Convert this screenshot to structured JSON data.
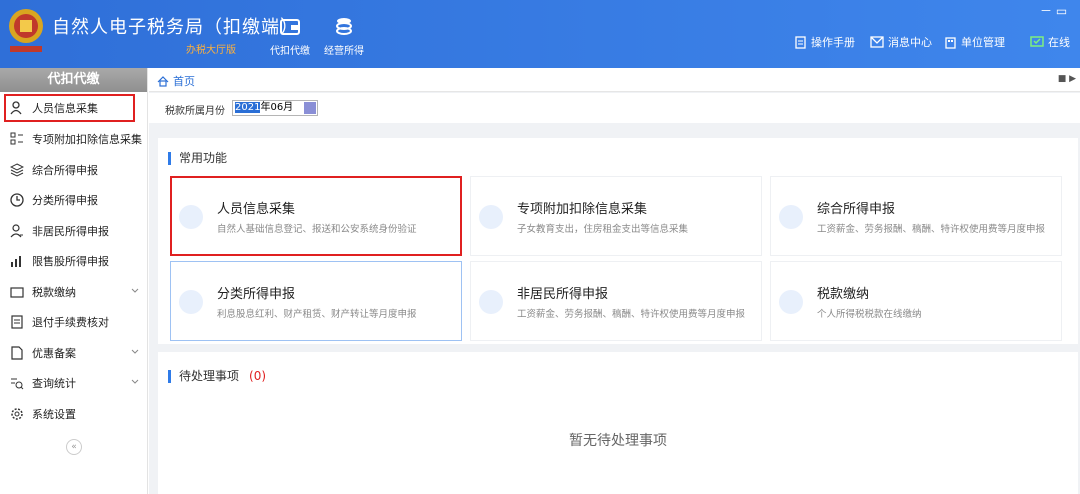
{
  "header": {
    "title": "自然人电子税务局（扣缴端）",
    "subtitle": "办税大厅版",
    "nav": [
      {
        "label": "代扣代缴",
        "icon": "wallet-icon"
      },
      {
        "label": "经营所得",
        "icon": "coins-icon"
      }
    ],
    "right": [
      {
        "label": "操作手册",
        "icon": "manual-icon"
      },
      {
        "label": "消息中心",
        "icon": "mail-icon"
      },
      {
        "label": "单位管理",
        "icon": "building-icon"
      },
      {
        "label": "在线",
        "icon": "online-icon"
      }
    ],
    "window_controls": "－ ▭"
  },
  "sidebar": {
    "heading": "代扣代缴",
    "items": [
      {
        "label": "人员信息采集",
        "icon": "user-icon"
      },
      {
        "label": "专项附加扣除信息采集",
        "icon": "grid-list-icon"
      },
      {
        "label": "综合所得申报",
        "icon": "layers-icon"
      },
      {
        "label": "分类所得申报",
        "icon": "clock-pie-icon"
      },
      {
        "label": "非居民所得申报",
        "icon": "person-icon"
      },
      {
        "label": "限售股所得申报",
        "icon": "bar-chart-icon"
      },
      {
        "label": "税款缴纳",
        "icon": "folder-icon"
      },
      {
        "label": "退付手续费核对",
        "icon": "receipt-icon"
      },
      {
        "label": "优惠备案",
        "icon": "document-icon"
      },
      {
        "label": "查询统计",
        "icon": "search-list-icon"
      },
      {
        "label": "系统设置",
        "icon": "gear-icon"
      }
    ],
    "collapse": "«"
  },
  "breadcrumb": {
    "home": "首页"
  },
  "filter": {
    "label": "税款所属月份",
    "value_sel": "2021",
    "value_rest": "年06月"
  },
  "common": {
    "title": "常用功能",
    "cards": [
      {
        "title": "人员信息采集",
        "desc": "自然人基础信息登记、报送和公安系统身份验证",
        "icon": "id-card-icon"
      },
      {
        "title": "专项附加扣除信息采集",
        "desc": "子女教育支出，住房租金支出等信息采集",
        "icon": "calendar-icon"
      },
      {
        "title": "综合所得申报",
        "desc": "工资薪金、劳务报酬、稿酬、特许权使用费等月度申报",
        "icon": "form-icon"
      },
      {
        "title": "分类所得申报",
        "desc": "利息股息红利、财产租赁、财产转让等月度申报",
        "icon": "edit-icon"
      },
      {
        "title": "非居民所得申报",
        "desc": "工资薪金、劳务报酬、稿酬、特许权使用费等月度申报",
        "icon": "edit-icon"
      },
      {
        "title": "税款缴纳",
        "desc": "个人所得税税款在线缴纳",
        "icon": "payment-icon"
      }
    ]
  },
  "pending": {
    "title": "待处理事项",
    "count": "(0)",
    "empty": "暂无待处理事项"
  },
  "colors": {
    "header_blue": "#3a7fe6",
    "accent": "#2f7be8",
    "highlight_red": "#e02020"
  }
}
